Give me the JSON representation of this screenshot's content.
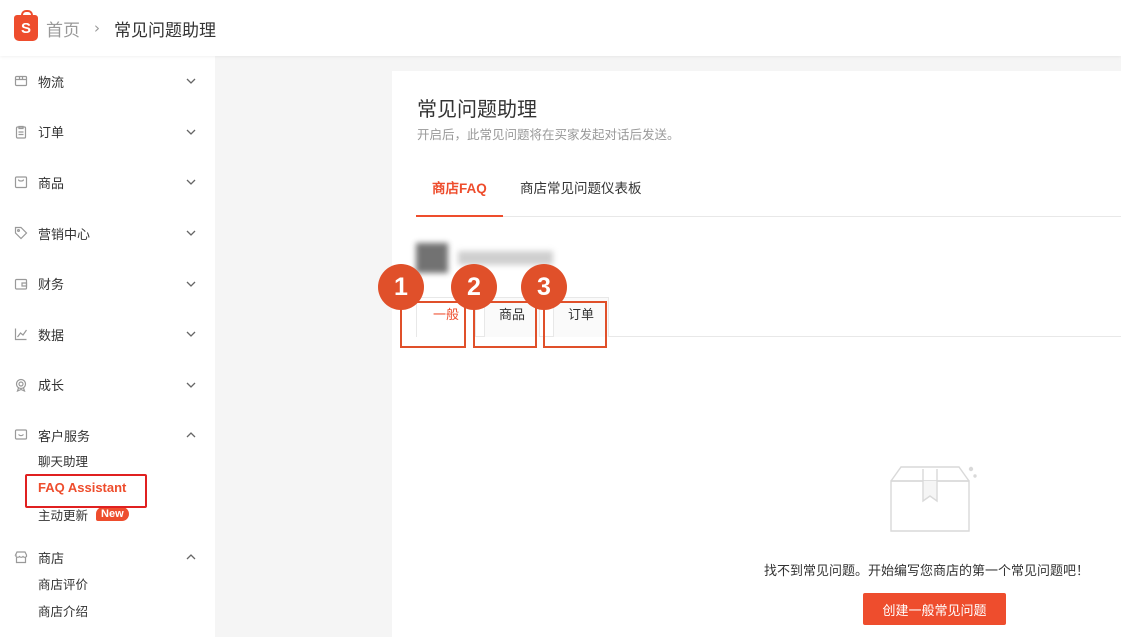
{
  "header": {
    "logo_letter": "S",
    "breadcrumb_home": "首页",
    "breadcrumb_sep": "›",
    "breadcrumb_current": "常见问题助理"
  },
  "sidebar": {
    "items": [
      {
        "label": "物流",
        "icon": "box-icon",
        "expanded": false
      },
      {
        "label": "订单",
        "icon": "clipboard-icon",
        "expanded": false
      },
      {
        "label": "商品",
        "icon": "bag-icon",
        "expanded": false
      },
      {
        "label": "营销中心",
        "icon": "tag-icon",
        "expanded": false
      },
      {
        "label": "财务",
        "icon": "wallet-icon",
        "expanded": false
      },
      {
        "label": "数据",
        "icon": "chart-icon",
        "expanded": false
      },
      {
        "label": "成长",
        "icon": "medal-icon",
        "expanded": false
      },
      {
        "label": "客户服务",
        "icon": "chat-icon",
        "expanded": true
      },
      {
        "label": "商店",
        "icon": "store-icon",
        "expanded": true
      }
    ],
    "customer_service_sub": [
      "聊天助理",
      "FAQ Assistant",
      "主动更新"
    ],
    "new_badge": "New",
    "store_sub": [
      "商店评价",
      "商店介绍"
    ]
  },
  "main": {
    "title": "常见问题助理",
    "subtitle": "开启后，此常见问题将在买家发起对话后发送。",
    "tabs": [
      "商店FAQ",
      "商店常见问题仪表板"
    ],
    "category_tabs": [
      "一般",
      "商品",
      "订单"
    ],
    "badges": [
      "1",
      "2",
      "3"
    ],
    "empty_text": "找不到常见问题。开始编写您商店的第一个常见问题吧！",
    "create_button": "创建一般常见问题"
  },
  "colors": {
    "brand": "#ee4d2d",
    "annotation": "#e0502a",
    "highlight_red": "#e02020"
  }
}
